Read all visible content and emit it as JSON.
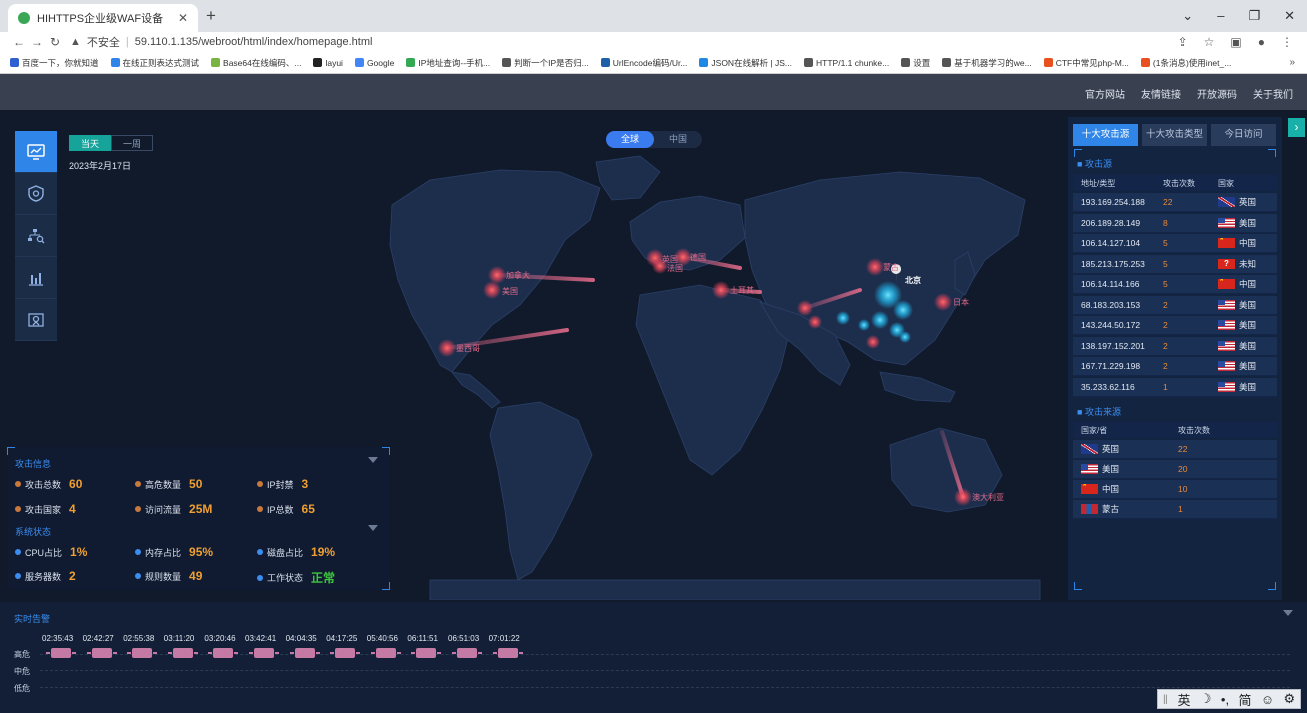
{
  "browser": {
    "tab_title": "HIHTTPS企业级WAF设备",
    "new_tab": "+",
    "security_label": "不安全",
    "url": "59.110.1.135/webroot/html/index/homepage.html",
    "bookmarks": [
      {
        "label": "百度一下，你就知道",
        "color": "#2f5fd0"
      },
      {
        "label": "在线正则表达式测试",
        "color": "#2f86e8"
      },
      {
        "label": "Base64在线编码、...",
        "color": "#7ab342"
      },
      {
        "label": "layui",
        "color": "#222222"
      },
      {
        "label": "Google",
        "color": "#4285f4"
      },
      {
        "label": "IP地址查询--手机...",
        "color": "#34a853"
      },
      {
        "label": "判断一个IP是否归...",
        "color": "#555555"
      },
      {
        "label": "UrlEncode编码/Ur...",
        "color": "#1f5fa8"
      },
      {
        "label": "JSON在线解析 | JS...",
        "color": "#1e88e5"
      },
      {
        "label": "HTTP/1.1 chunke...",
        "color": "#555555"
      },
      {
        "label": "设置",
        "color": "#555555"
      },
      {
        "label": "基于机器学习的we...",
        "color": "#555555"
      },
      {
        "label": "CTF中常见php-M...",
        "color": "#e8501e"
      },
      {
        "label": "(1条消息)使用inet_...",
        "color": "#e8501e"
      }
    ],
    "more": "»"
  },
  "topnav": {
    "links": [
      "官方网站",
      "友情链接",
      "开放源码",
      "关于我们"
    ]
  },
  "range": {
    "today": "当天",
    "week": "一周",
    "date": "2023年2月17日"
  },
  "scope": {
    "global": "全球",
    "china": "中国"
  },
  "map_labels": [
    {
      "text": "加拿大",
      "color": "#e26a8a"
    },
    {
      "text": "美国",
      "color": "#e26a8a"
    },
    {
      "text": "墨西哥",
      "color": "#e26a8a"
    },
    {
      "text": "英国",
      "color": "#e26a8a"
    },
    {
      "text": "德国",
      "color": "#e26a8a"
    },
    {
      "text": "法国",
      "color": "#e26a8a"
    },
    {
      "text": "土耳其",
      "color": "#e26a8a"
    },
    {
      "text": "蒙古",
      "color": "#e26a8a"
    },
    {
      "text": "日本",
      "color": "#e26a8a"
    },
    {
      "text": "澳大利亚",
      "color": "#e26a8a"
    },
    {
      "text": "北京",
      "color": "#ffffff"
    }
  ],
  "attack_info": {
    "title": "攻击信息",
    "total_attacks": {
      "label": "攻击总数",
      "value": "60"
    },
    "high_risk": {
      "label": "高危数量",
      "value": "50"
    },
    "ip_blocked": {
      "label": "IP封禁",
      "value": "3"
    },
    "countries": {
      "label": "攻击国家",
      "value": "4"
    },
    "traffic": {
      "label": "访问流量",
      "value": "25M"
    },
    "ip_total": {
      "label": "IP总数",
      "value": "65"
    }
  },
  "system_status": {
    "title": "系统状态",
    "cpu": {
      "label": "CPU占比",
      "value": "1%"
    },
    "memory": {
      "label": "内存占比",
      "value": "95%"
    },
    "disk": {
      "label": "磁盘占比",
      "value": "19%"
    },
    "servers": {
      "label": "服务器数",
      "value": "2"
    },
    "rules": {
      "label": "规则数量",
      "value": "49"
    },
    "work": {
      "label": "工作状态",
      "value": "正常"
    }
  },
  "right_panel": {
    "tabs": [
      "十大攻击源",
      "十大攻击类型",
      "今日访问"
    ],
    "sources_title": "攻击源",
    "sources_headers": [
      "地址/类型",
      "攻击次数",
      "国家"
    ],
    "sources": [
      {
        "ip": "193.169.254.188",
        "count": "22",
        "country": "英国",
        "flag": "uk"
      },
      {
        "ip": "206.189.28.149",
        "count": "8",
        "country": "美国",
        "flag": "us"
      },
      {
        "ip": "106.14.127.104",
        "count": "5",
        "country": "中国",
        "flag": "cn"
      },
      {
        "ip": "185.213.175.253",
        "count": "5",
        "country": "未知",
        "flag": "unk"
      },
      {
        "ip": "106.14.114.166",
        "count": "5",
        "country": "中国",
        "flag": "cn"
      },
      {
        "ip": "68.183.203.153",
        "count": "2",
        "country": "美国",
        "flag": "us"
      },
      {
        "ip": "143.244.50.172",
        "count": "2",
        "country": "美国",
        "flag": "us"
      },
      {
        "ip": "138.197.152.201",
        "count": "2",
        "country": "美国",
        "flag": "us"
      },
      {
        "ip": "167.71.229.198",
        "count": "2",
        "country": "美国",
        "flag": "us"
      },
      {
        "ip": "35.233.62.116",
        "count": "1",
        "country": "美国",
        "flag": "us"
      }
    ],
    "origin_title": "攻击来源",
    "origin_headers": [
      "国家/省",
      "攻击次数"
    ],
    "origins": [
      {
        "country": "英国",
        "count": "22",
        "flag": "uk"
      },
      {
        "country": "美国",
        "count": "20",
        "flag": "us"
      },
      {
        "country": "中国",
        "count": "10",
        "flag": "cn"
      },
      {
        "country": "蒙古",
        "count": "1",
        "flag": "mn"
      }
    ]
  },
  "alert": {
    "title": "实时告警",
    "levels": [
      "高危",
      "中危",
      "低危"
    ],
    "times": [
      "02:35:43",
      "02:42:27",
      "02:55:38",
      "03:11:20",
      "03:20:46",
      "03:42:41",
      "04:04:35",
      "04:17:25",
      "05:40:56",
      "06:11:51",
      "06:51:03",
      "07:01:22"
    ]
  },
  "ime": {
    "lang": "英",
    "simp": "简"
  }
}
